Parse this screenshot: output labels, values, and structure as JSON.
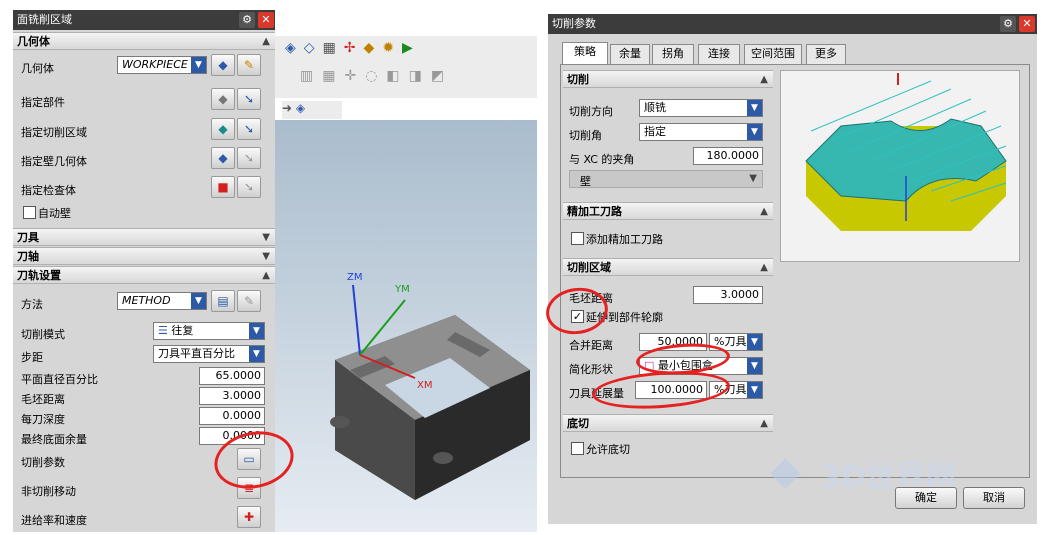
{
  "left": {
    "title": "面铣削区域",
    "geometry": {
      "header": "几何体",
      "geometry_label": "几何体",
      "geometry_value": "WORKPIECE",
      "specify_part": "指定部件",
      "specify_cut_area": "指定切削区域",
      "specify_wall": "指定壁几何体",
      "specify_check": "指定检查体",
      "auto_wall": "自动壁"
    },
    "sections": {
      "tool": "刀具",
      "axis": "刀轴",
      "path_settings": "刀轨设置"
    },
    "path": {
      "method_label": "方法",
      "method_value": "METHOD",
      "cut_pattern_label": "切削模式",
      "cut_pattern_value": "往复",
      "stepover_label": "步距",
      "stepover_value": "刀具平直百分比",
      "flat_pct_label": "平面直径百分比",
      "flat_pct_value": "65.0000",
      "blank_dist_label": "毛坯距离",
      "blank_dist_value": "3.0000",
      "depth_label": "每刀深度",
      "depth_value": "0.0000",
      "floor_stock_label": "最终底面余量",
      "floor_stock_value": "0.0000",
      "cut_params_label": "切削参数",
      "noncut_label": "非切削移动",
      "feeds_label": "进给率和速度"
    }
  },
  "viewport": {
    "axis_zm": "ZM",
    "axis_ym": "YM",
    "axis_xm": "XM",
    "colors": {
      "bg": "#c9d6e3",
      "zm": "#2340d8",
      "ym": "#1aa01a",
      "xm": "#d22020"
    }
  },
  "right": {
    "title": "切削参数",
    "tabs": [
      "策略",
      "余量",
      "拐角",
      "连接",
      "空间范围",
      "更多"
    ],
    "cutting": {
      "header": "切削",
      "direction_label": "切削方向",
      "direction_value": "顺铣",
      "angle_label": "切削角",
      "angle_value": "指定",
      "xc_angle_label": "与 XC 的夹角",
      "xc_angle_value": "180.0000",
      "wall_label": "壁"
    },
    "finish": {
      "header": "精加工刀路",
      "add_finish": "添加精加工刀路"
    },
    "region": {
      "header": "切削区域",
      "blank_dist_label": "毛坯距离",
      "blank_dist_value": "3.0000",
      "extend_label": "延伸到部件轮廓",
      "merge_dist_label": "合并距离",
      "merge_dist_value": "50.0000",
      "merge_unit": "%刀具",
      "simplify_label": "简化形状",
      "simplify_value": "最小包围盒",
      "extend_amount_label": "刀具延展量",
      "extend_amount_value": "100.0000",
      "extend_unit": "%刀具"
    },
    "undercut": {
      "header": "底切",
      "allow": "允许底切"
    },
    "ok": "确定",
    "cancel": "取消"
  },
  "watermark": "3D世界网"
}
